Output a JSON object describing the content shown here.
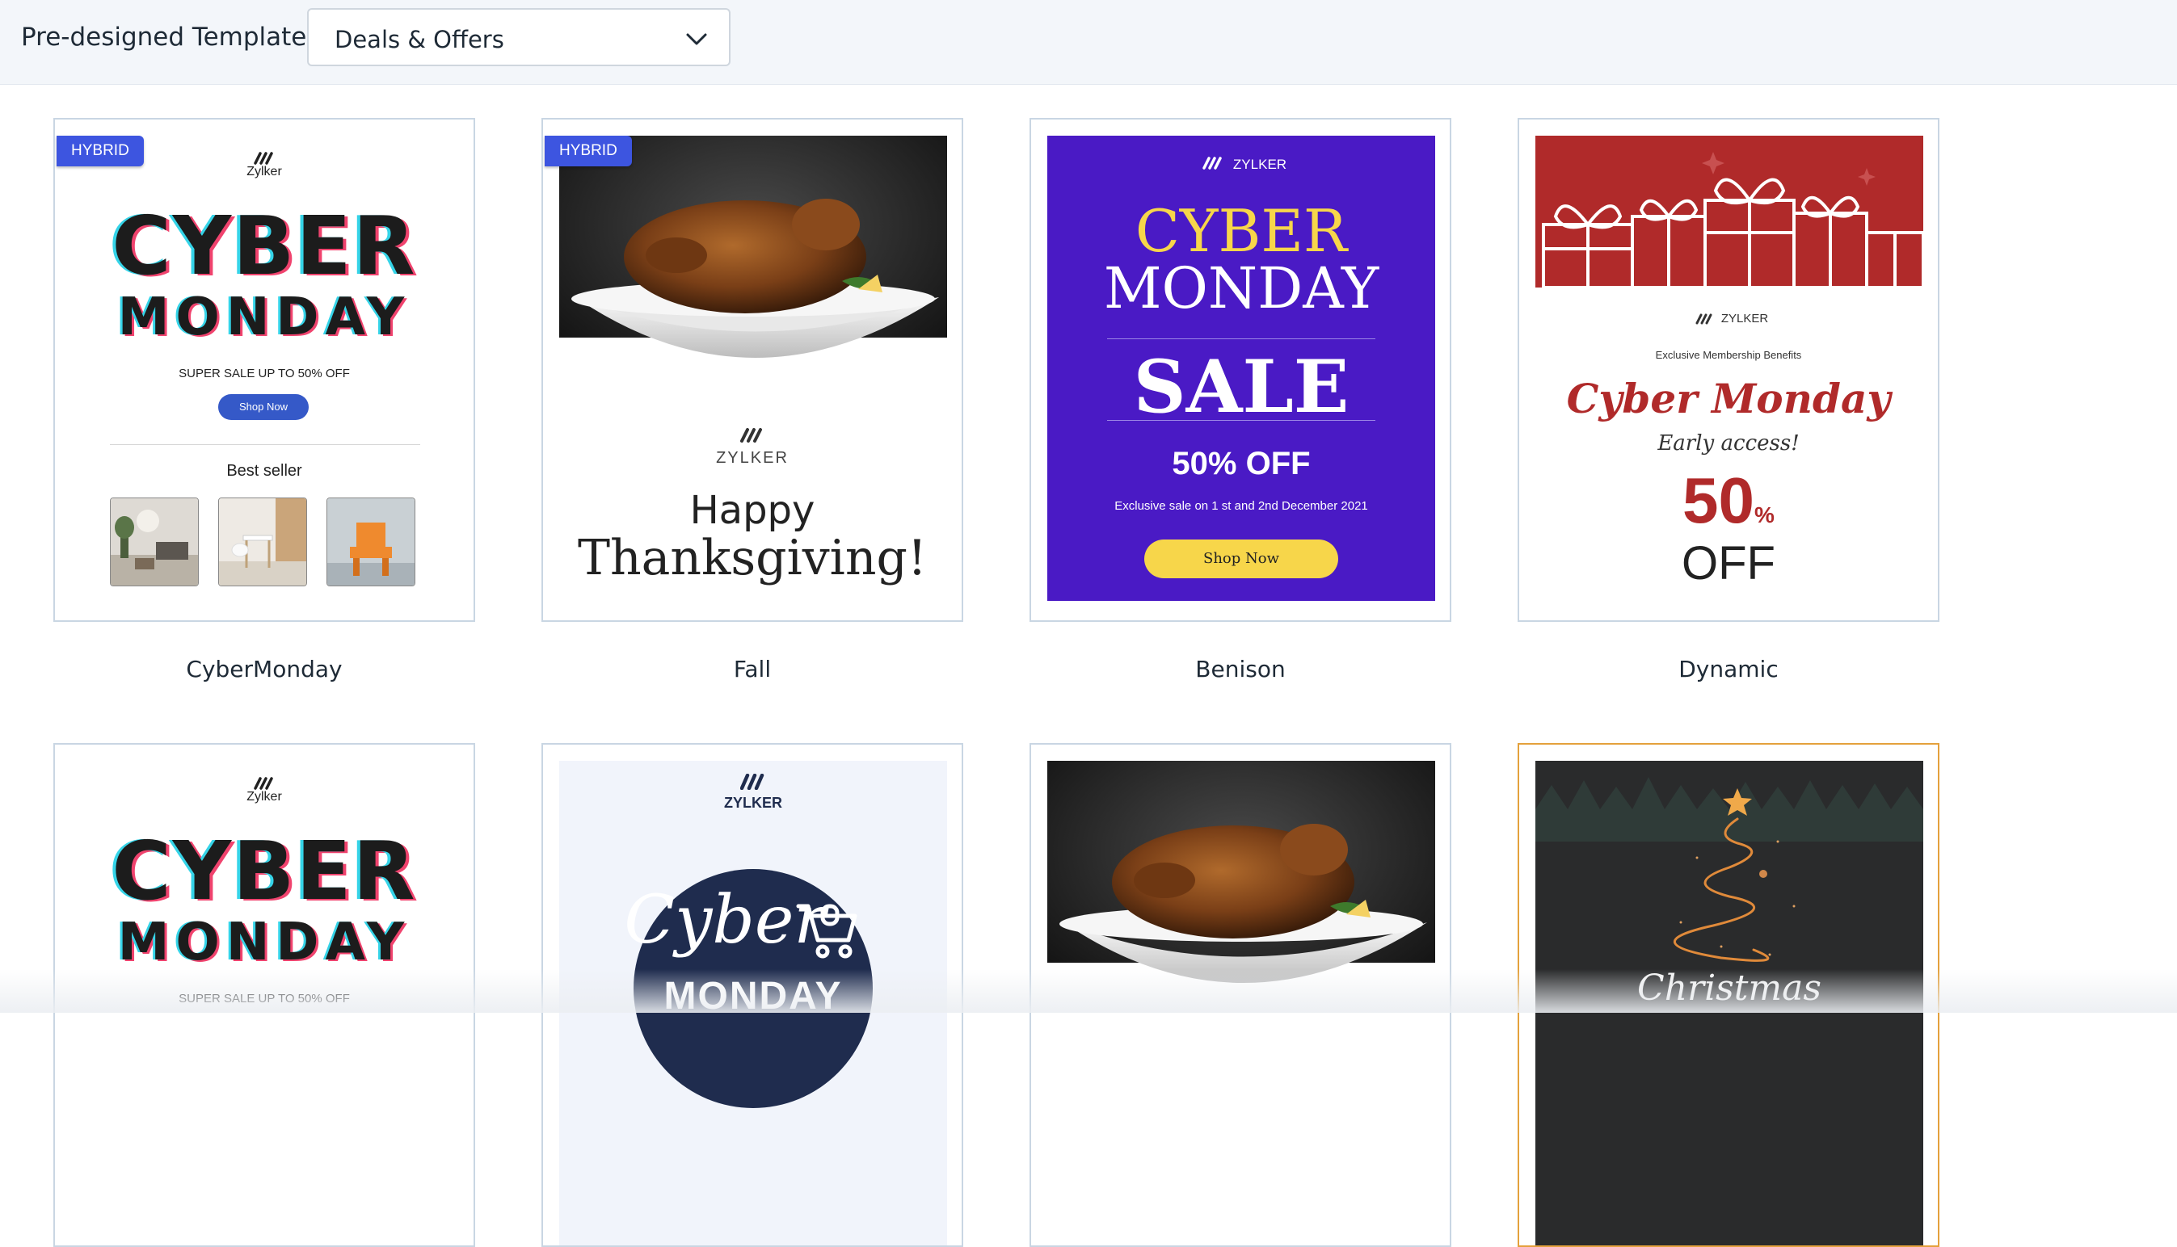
{
  "header": {
    "title": "Pre-designed Templates",
    "category_select": {
      "value": "Deals & Offers"
    }
  },
  "templates": [
    {
      "name": "CyberMonday",
      "badge": "HYBRID",
      "brand": "Zylker",
      "headline_1": "CYBER",
      "headline_2": "MONDAY",
      "subtext": "SUPER SALE UP TO 50% OFF",
      "button": "Shop Now",
      "section_title": "Best seller"
    },
    {
      "name": "Fall",
      "badge": "HYBRID",
      "brand": "ZYLKER",
      "headline_1": "Happy",
      "headline_2": "Thanksgiving!"
    },
    {
      "name": "Benison",
      "brand": "ZYLKER",
      "headline_1": "CYBER",
      "headline_2": "MONDAY",
      "headline_3": "SALE",
      "offer": "50% OFF",
      "subtext": "Exclusive sale on 1 st and 2nd December 2021",
      "button": "Shop Now",
      "colors": {
        "background": "#4a1ac5",
        "accent": "#f7d64a"
      }
    },
    {
      "name": "Dynamic",
      "brand": "ZYLKER",
      "subtext": "Exclusive Membership Benefits",
      "headline_1": "Cyber Monday",
      "headline_2": "Early access!",
      "offer_number": "50",
      "offer_unit": "%",
      "offer_text": "OFF",
      "colors": {
        "banner": "#b02a2a"
      }
    },
    {
      "brand": "Zylker",
      "headline_1": "CYBER",
      "headline_2": "MONDAY",
      "subtext": "SUPER SALE UP TO 50% OFF"
    },
    {
      "brand": "ZYLKER",
      "headline_1": "Cyber",
      "headline_2": "MONDAY"
    },
    {},
    {
      "headline_1": "Christmas"
    }
  ]
}
